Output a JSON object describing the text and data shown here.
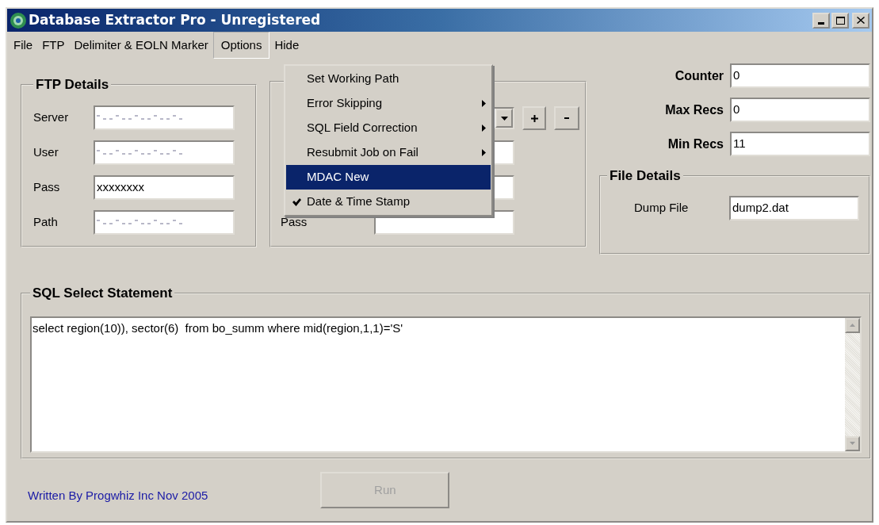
{
  "window": {
    "title": "Database Extractor Pro - Unregistered"
  },
  "menu_bar": [
    {
      "label": "File",
      "selected": false
    },
    {
      "label": "FTP",
      "selected": false
    },
    {
      "label": "Delimiter & EOLN Marker",
      "selected": false
    },
    {
      "label": "Options",
      "selected": true
    },
    {
      "label": "Hide",
      "selected": false
    }
  ],
  "options_menu": [
    {
      "label": "Set Working Path",
      "submenu": false,
      "checked": false,
      "selected": false
    },
    {
      "label": "Error Skipping",
      "submenu": true,
      "checked": false,
      "selected": false
    },
    {
      "label": "SQL Field Correction",
      "submenu": true,
      "checked": false,
      "selected": false
    },
    {
      "label": "Resubmit Job on Fail",
      "submenu": true,
      "checked": false,
      "selected": false
    },
    {
      "label": "MDAC New",
      "submenu": false,
      "checked": false,
      "selected": true
    },
    {
      "label": "Date & Time Stamp",
      "submenu": false,
      "checked": true,
      "selected": false
    }
  ],
  "ftp_details": {
    "title": "FTP Details",
    "fields": [
      {
        "label": "Server",
        "obscured": true
      },
      {
        "label": "User",
        "obscured": true
      },
      {
        "label": "Pass",
        "value": "xxxxxxxx",
        "obscured": false
      },
      {
        "label": "Path",
        "obscured": true
      }
    ]
  },
  "database_details": {
    "fields": [
      {
        "label": "Pass"
      }
    ]
  },
  "counters": [
    {
      "label": "Counter",
      "value": "0"
    },
    {
      "label": "Max Recs",
      "value": "0"
    },
    {
      "label": "Min Recs",
      "value": "11"
    }
  ],
  "file_details": {
    "title": "File Details",
    "fields": [
      {
        "label": "Dump File",
        "value": "dump2.dat"
      }
    ]
  },
  "sql": {
    "title": "SQL Select Statement",
    "value": "select region(10)), sector(6)  from bo_summ where mid(region,1,1)='S'"
  },
  "footer": {
    "credit": "Written By Progwhiz Inc Nov 2005",
    "run_button": {
      "label": "Run",
      "disabled": true
    }
  }
}
